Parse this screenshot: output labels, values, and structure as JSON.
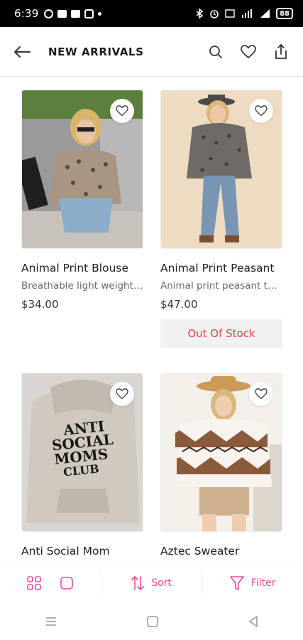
{
  "status_bar": {
    "time": "6:39",
    "battery": "88"
  },
  "header": {
    "title": "NEW ARRIVALS"
  },
  "products": [
    {
      "name": "Animal Print Blouse",
      "description": "Breathable light weight…",
      "price": "$34.00",
      "out_of_stock": false
    },
    {
      "name": "Animal Print Peasant",
      "description": "Animal print peasant t…",
      "price": "$47.00",
      "out_of_stock": true,
      "stock_label": "Out Of Stock"
    },
    {
      "name": "Anti Social Mom",
      "description": "",
      "price": "",
      "out_of_stock": false,
      "graphic_text": [
        "ANTI",
        "SOCIAL",
        "MOMS",
        "CLUB"
      ]
    },
    {
      "name": "Aztec Sweater",
      "description": "",
      "price": "",
      "out_of_stock": false
    }
  ],
  "bottom_bar": {
    "sort_label": "Sort",
    "filter_label": "Filter"
  },
  "colors": {
    "accent": "#e54c9a",
    "out_of_stock_text": "#e0464b"
  }
}
